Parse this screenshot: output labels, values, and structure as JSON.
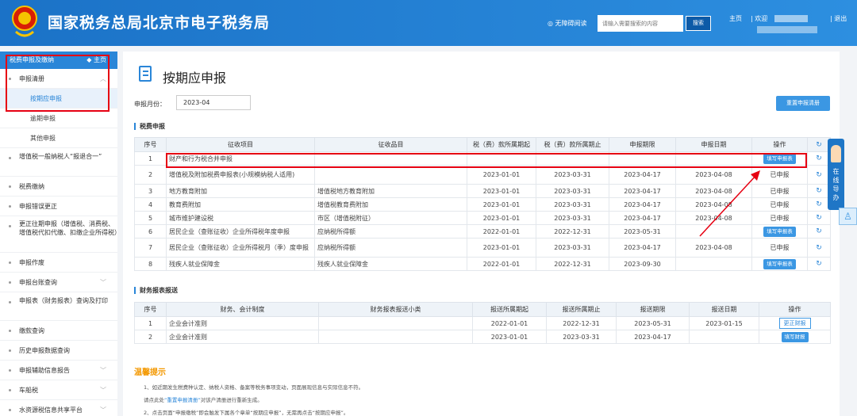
{
  "header": {
    "title": "国家税务总局北京市电子税务局",
    "accessibility": "◎ 无障碍阅读",
    "search_placeholder": "请输入需要搜索的内容",
    "search_label": "搜索",
    "home": "主页",
    "welcome": "| 欢迎",
    "logout": "| 退出"
  },
  "sidebar": {
    "head": "税费申报及缴纳",
    "home": "◆ 主页",
    "items": [
      {
        "label": "申报清册"
      },
      {
        "label": "按期应申报"
      },
      {
        "label": "逾期申报"
      },
      {
        "label": "其他申报"
      },
      {
        "label": "增值税一般纳税人“报退合一”"
      },
      {
        "label": "税费缴纳"
      },
      {
        "label": "申报错误更正"
      },
      {
        "label": "更正往期申报（增值税、消费税、增值税代扣代缴、扣缴企业所得税）"
      },
      {
        "label": "申报作废"
      },
      {
        "label": "申报台账查询"
      },
      {
        "label": "申报表（财务报表）查询及打印"
      },
      {
        "label": "缴款查询"
      },
      {
        "label": "历史申报数据查询"
      },
      {
        "label": "申报辅助信息报告"
      },
      {
        "label": "车船税"
      },
      {
        "label": "水资源税信息共享平台"
      }
    ]
  },
  "main": {
    "title": "按期应申报",
    "month_label": "申报月份：",
    "month_value": "2023-04",
    "reset_button": "重置申报清册",
    "tax_section": "税费申报",
    "tax_headers": [
      "序号",
      "征收项目",
      "征收品目",
      "税（费）款所属期起",
      "税（费）款所属期止",
      "申报期限",
      "申报日期",
      "操作"
    ],
    "tax_rows": [
      {
        "no": "1",
        "item": "财产和行为税合并申报",
        "sub": "",
        "start": "",
        "end": "",
        "deadline": "",
        "date": "",
        "op": "填写申报表",
        "op_type": "btn"
      },
      {
        "no": "2",
        "item": "增值税及附加税费申报表(小规模纳税人适用)",
        "sub": "",
        "start": "2023-01-01",
        "end": "2023-03-31",
        "deadline": "2023-04-17",
        "date": "2023-04-08",
        "op": "已申报",
        "op_type": "text"
      },
      {
        "no": "3",
        "item": "地方教育附加",
        "sub": "增值税地方教育附加",
        "start": "2023-01-01",
        "end": "2023-03-31",
        "deadline": "2023-04-17",
        "date": "2023-04-08",
        "op": "已申报",
        "op_type": "text"
      },
      {
        "no": "4",
        "item": "教育费附加",
        "sub": "增值税教育费附加",
        "start": "2023-01-01",
        "end": "2023-03-31",
        "deadline": "2023-04-17",
        "date": "2023-04-08",
        "op": "已申报",
        "op_type": "text"
      },
      {
        "no": "5",
        "item": "城市维护建设税",
        "sub": "市区（增值税附征）",
        "start": "2023-01-01",
        "end": "2023-03-31",
        "deadline": "2023-04-17",
        "date": "2023-04-08",
        "op": "已申报",
        "op_type": "text"
      },
      {
        "no": "6",
        "item": "居民企业（查账征收）企业所得税年度申报",
        "sub": "应纳税所得额",
        "start": "2022-01-01",
        "end": "2022-12-31",
        "deadline": "2023-05-31",
        "date": "",
        "op": "填写申报表",
        "op_type": "btn"
      },
      {
        "no": "7",
        "item": "居民企业（查账征收）企业所得税月（季）度申报",
        "sub": "应纳税所得额",
        "start": "2023-01-01",
        "end": "2023-03-31",
        "deadline": "2023-04-17",
        "date": "2023-04-08",
        "op": "已申报",
        "op_type": "text"
      },
      {
        "no": "8",
        "item": "残疾人就业保障金",
        "sub": "残疾人就业保障金",
        "start": "2022-01-01",
        "end": "2022-12-31",
        "deadline": "2023-09-30",
        "date": "",
        "op": "填写申报表",
        "op_type": "btn"
      }
    ],
    "fin_section": "财务报表报送",
    "fin_headers": [
      "序号",
      "财务、会计制度",
      "财务报表报送小类",
      "报送所属期起",
      "报送所属期止",
      "报送期限",
      "报送日期",
      "操作"
    ],
    "fin_rows": [
      {
        "no": "1",
        "system": "企业会计准则",
        "sub": "",
        "start": "2022-01-01",
        "end": "2022-12-31",
        "deadline": "2023-05-31",
        "date": "2023-01-15",
        "op": "更正财报",
        "op_type": "outline"
      },
      {
        "no": "2",
        "system": "企业会计准则",
        "sub": "",
        "start": "2023-01-01",
        "end": "2023-03-31",
        "deadline": "2023-04-17",
        "date": "",
        "op": "填写财报",
        "op_type": "btn"
      }
    ],
    "tips_title": "温馨提示",
    "tip1": "1、如近期发生税费种认定、纳税人资格、备案等税务事项变动，页面展现信息与实际信息不符。",
    "tip2_pre": "请点此处",
    "tip2_link": "“重置申报清册”",
    "tip2_post": "对该户清册进行重新生成。",
    "tip3": "2、点击页面“申报缴税”即会触发下属各个章单“按期应申报”，无需再点击“按期应申报”。"
  },
  "float": {
    "help": "在线导办"
  },
  "colors": {
    "header_blue": "#1b72c7",
    "accent": "#2a86d8",
    "highlight_red": "#e60012",
    "tips_orange": "#f39800"
  }
}
